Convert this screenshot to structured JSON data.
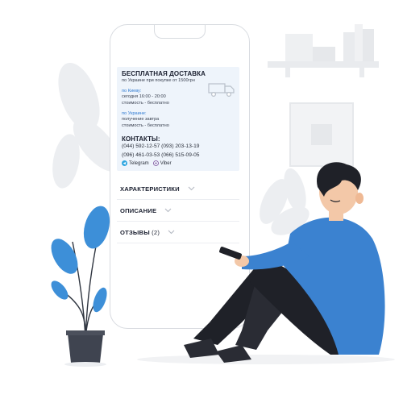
{
  "delivery": {
    "title": "БЕСПЛАТНАЯ ДОСТАВКА",
    "subtitle": "по Украине при покупке от 1500грн",
    "kyiv": {
      "label": "по Киеву:",
      "line1": "сегодня 16:00 - 20:00",
      "line2": "стоимость - бесплатно"
    },
    "ukraine": {
      "label": "по Украине:",
      "line1": "получение завтра",
      "line2": "стоимость - бесплатно"
    }
  },
  "contacts": {
    "title": "КОНТАКТЫ:",
    "phones": [
      "(044) 592-12-57  (093) 203-13-19",
      "(096) 461-03-53  (066) 515-09-05"
    ],
    "messengers": [
      "Telegram",
      "Viber"
    ]
  },
  "accordion": {
    "characteristics": "ХАРАКТЕРИСТИКИ",
    "description": "ОПИСАНИЕ",
    "reviews": "ОТЗЫВЫ",
    "reviews_count": "(2)"
  },
  "colors": {
    "accent": "#3d8fd8",
    "shirt": "#3b82d0",
    "pants": "#1f2128",
    "decor": "#eceef1"
  },
  "icons": [
    "truck-icon",
    "telegram-icon",
    "viber-icon",
    "chevron-down-icon"
  ]
}
